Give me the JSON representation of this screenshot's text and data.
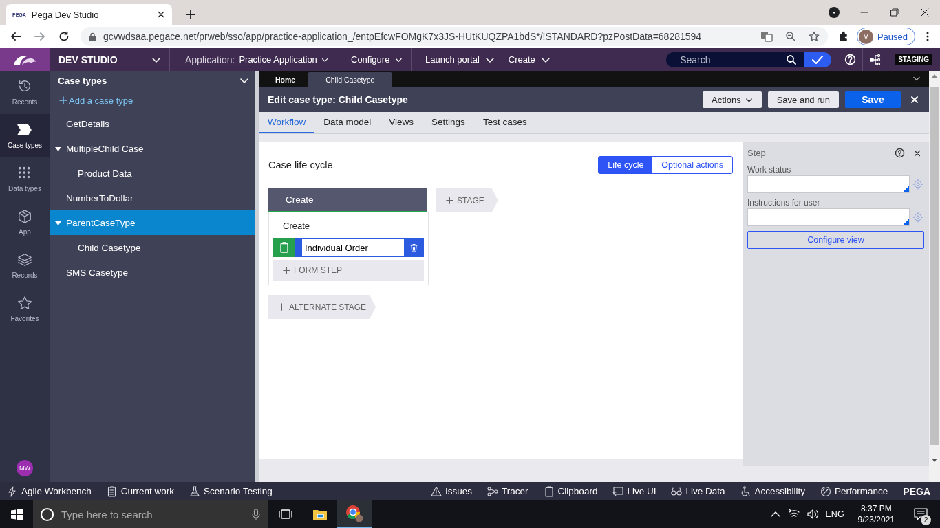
{
  "browser": {
    "favicon_text": "PEGA",
    "tab_title": "Pega Dev Studio",
    "url": "gcvwdsaa.pegace.net/prweb/sso/app/practice-application_/entpEfcwFOMgK7x3JS-HUtKUQZPA1bdS*/!STANDARD?pzPostData=68281594",
    "profile_initial": "V",
    "profile_status": "Paused"
  },
  "header": {
    "studio": "DEV STUDIO",
    "application_label": "Application:",
    "application": "Practice Application",
    "menus": [
      "Configure",
      "Launch portal",
      "Create"
    ],
    "search": {
      "placeholder": "Search"
    },
    "environment": "STAGING"
  },
  "nav": {
    "items": [
      {
        "kind": "recents",
        "label": "Recents",
        "selected": false
      },
      {
        "kind": "casetypes",
        "label": "Case types",
        "selected": true
      },
      {
        "kind": "datatypes",
        "label": "Data types",
        "selected": false
      },
      {
        "kind": "app",
        "label": "App",
        "selected": false
      },
      {
        "kind": "records",
        "label": "Records",
        "selected": false
      },
      {
        "kind": "favorites",
        "label": "Favorites",
        "selected": false
      }
    ],
    "avatar": "MW"
  },
  "explorer": {
    "title": "Case types",
    "add": "Add a case type",
    "tree": [
      {
        "label": "GetDetails",
        "selected": false
      },
      {
        "label": "MultipleChild Case",
        "selected": false,
        "expanded": true,
        "children": [
          {
            "label": "Product Data",
            "selected": false
          }
        ]
      },
      {
        "label": "NumberToDollar",
        "selected": false
      },
      {
        "label": "ParentCaseType",
        "selected": true,
        "expanded": true,
        "children": [
          {
            "label": "Child Casetype",
            "selected": false
          }
        ]
      },
      {
        "label": "SMS Casetype",
        "selected": false
      }
    ]
  },
  "work_tabs": [
    {
      "label": "Home",
      "selected": false
    },
    {
      "label": "Child Casetype",
      "selected": true
    }
  ],
  "editor": {
    "title_label": "Edit case type:",
    "title": "Child Casetype",
    "actions": "Actions",
    "save_and_run": "Save and run",
    "save": "Save",
    "tabs": [
      {
        "label": "Workflow",
        "selected": true
      },
      {
        "label": "Data model",
        "selected": false
      },
      {
        "label": "Views",
        "selected": false
      },
      {
        "label": "Settings",
        "selected": false
      },
      {
        "label": "Test cases",
        "selected": false
      }
    ]
  },
  "lifecycle": {
    "heading": "Case life cycle",
    "views": [
      {
        "label": "Life cycle",
        "selected": true
      },
      {
        "label": "Optional actions",
        "selected": false
      }
    ],
    "stages": [
      {
        "name": "Create",
        "processes": [
          {
            "name": "Create",
            "steps": [
              {
                "value": "Individual Order"
              }
            ]
          }
        ],
        "add_step": "FORM STEP"
      }
    ],
    "add_stage": "STAGE",
    "add_alternate": "ALTERNATE STAGE"
  },
  "step_panel": {
    "title": "Step",
    "fields": [
      {
        "label": "Work status"
      },
      {
        "label": "Instructions for user"
      }
    ],
    "button": "Configure view"
  },
  "dev_bar": {
    "left": [
      {
        "kind": "bolt",
        "label": "Agile Workbench"
      },
      {
        "kind": "list",
        "label": "Current work"
      },
      {
        "kind": "flask",
        "label": "Scenario Testing"
      }
    ],
    "right": [
      {
        "kind": "warning",
        "label": "Issues"
      },
      {
        "kind": "tracer",
        "label": "Tracer"
      },
      {
        "kind": "clipboard",
        "label": "Clipboard"
      },
      {
        "kind": "liveui",
        "label": "Live UI"
      },
      {
        "kind": "glasses",
        "label": "Live Data"
      },
      {
        "kind": "access",
        "label": "Accessibility"
      },
      {
        "kind": "gauge",
        "label": "Performance"
      }
    ],
    "brand": "PEGA"
  },
  "taskbar": {
    "search": {
      "placeholder": "Type here to search"
    },
    "language": "ENG",
    "time": "8:37 PM",
    "date": "9/23/2021",
    "notifications": "2"
  }
}
